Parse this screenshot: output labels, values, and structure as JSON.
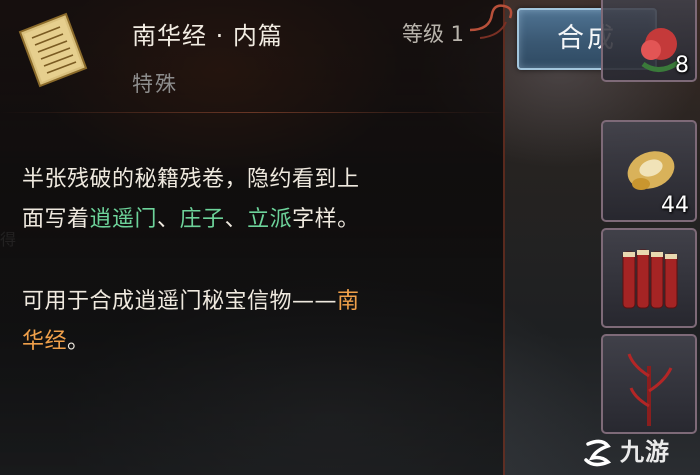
{
  "item": {
    "name": "南华经 · 内篇",
    "type": "特殊",
    "level": "等级 1",
    "icon": "scroll-manuscript-icon"
  },
  "description": {
    "line1": "半张残破的秘籍残卷，隐约看到上",
    "line2_prefix": "面写着",
    "kw1": "逍遥门",
    "sep1": "、",
    "kw2": "庄子",
    "sep2": "、",
    "kw3": "立派",
    "line2_suffix": "字样。",
    "use_prefix": "可用于合成逍遥门秘宝信物——",
    "use_item_a": "南",
    "use_item_b": "华经",
    "use_suffix": "。"
  },
  "background_text": "得",
  "actions": {
    "synth_label": "合成"
  },
  "inventory": [
    {
      "icon": "red-flower-item-icon",
      "count": "8"
    },
    {
      "icon": "gold-jade-ornament-icon",
      "count": "44"
    },
    {
      "icon": "red-scroll-bundle-icon",
      "count": ""
    },
    {
      "icon": "red-plant-item-icon",
      "count": ""
    }
  ],
  "watermark": {
    "text": "九游",
    "icon": "jiuyou-logo-icon"
  },
  "colors": {
    "keyword_green": "#6dd39a",
    "keyword_orange": "#f0a04a",
    "button_blue": "#3a5873"
  }
}
